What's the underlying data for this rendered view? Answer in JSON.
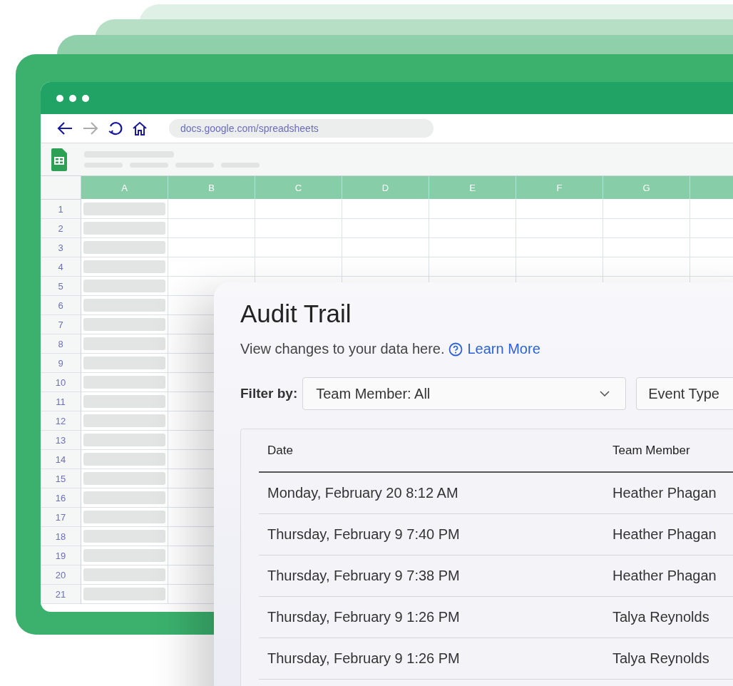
{
  "browser": {
    "url": "docs.google.com/spreadsheets"
  },
  "spreadsheet": {
    "columns": [
      "A",
      "B",
      "C",
      "D",
      "E",
      "F",
      "G"
    ],
    "row_numbers": [
      "1",
      "2",
      "3",
      "4",
      "5",
      "6",
      "7",
      "8",
      "9",
      "10",
      "11",
      "12",
      "13",
      "14",
      "15",
      "16",
      "17",
      "18",
      "19",
      "20",
      "21"
    ]
  },
  "audit_panel": {
    "title": "Audit Trail",
    "description": "View changes to your data here.",
    "learn_more": "Learn More",
    "filter_label": "Filter by:",
    "filters": [
      {
        "label": "Team Member: All"
      },
      {
        "label": "Event Type"
      }
    ],
    "table": {
      "columns": [
        "Date",
        "Team Member"
      ],
      "rows": [
        {
          "date": "Monday, February 20 8:12 AM",
          "member": "Heather Phagan"
        },
        {
          "date": "Thursday, February 9 7:40 PM",
          "member": "Heather Phagan"
        },
        {
          "date": "Thursday, February 9 7:38 PM",
          "member": "Heather Phagan"
        },
        {
          "date": "Thursday, February 9 1:26 PM",
          "member": "Talya Reynolds"
        },
        {
          "date": "Thursday, February 9 1:26 PM",
          "member": "Talya Reynolds"
        }
      ]
    }
  }
}
